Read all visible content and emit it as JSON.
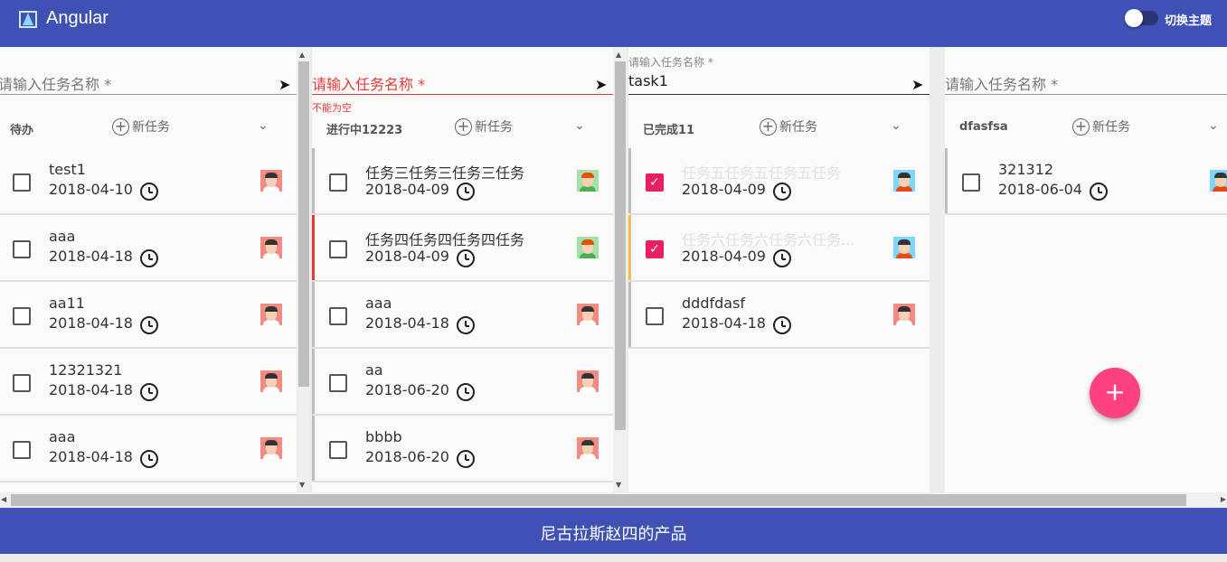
{
  "header": {
    "brand": "Angular",
    "theme_label": "切换主题"
  },
  "footer": {
    "text": "尼古拉斯赵四的产品"
  },
  "lists": [
    {
      "input": {
        "placeholder": "请输入任务名称 *",
        "value": "",
        "float_label": "",
        "error": ""
      },
      "title": "待办",
      "new_label": "新任务",
      "items": [
        {
          "desc": "test1",
          "date": "2018-04-10",
          "done": false
        },
        {
          "desc": "aaa",
          "date": "2018-04-18",
          "done": false
        },
        {
          "desc": "aa11",
          "date": "2018-04-18",
          "done": false
        },
        {
          "desc": "12321321",
          "date": "2018-04-18",
          "done": false
        },
        {
          "desc": "aaa",
          "date": "2018-04-18",
          "done": false
        }
      ]
    },
    {
      "input": {
        "placeholder": "请输入任务名称 *",
        "value": "",
        "float_label": "",
        "error": "不能为空"
      },
      "title": "进行中12223",
      "new_label": "新任务",
      "items": [
        {
          "desc": "任务三任务三任务三任务",
          "date": "2018-04-09",
          "done": false
        },
        {
          "desc": "任务四任务四任务四任务",
          "date": "2018-04-09",
          "done": false
        },
        {
          "desc": "aaa",
          "date": "2018-04-18",
          "done": false
        },
        {
          "desc": "aa",
          "date": "2018-06-20",
          "done": false
        },
        {
          "desc": "bbbb",
          "date": "2018-06-20",
          "done": false
        }
      ]
    },
    {
      "input": {
        "placeholder": "",
        "value": "task1",
        "float_label": "请输入任务名称 *",
        "error": ""
      },
      "title": "已完成11",
      "new_label": "新任务",
      "items": [
        {
          "desc": "任务五任务五任务五任务",
          "date": "2018-04-09",
          "done": true
        },
        {
          "desc": "任务六任务六任务六任务...",
          "date": "2018-04-09",
          "done": true
        },
        {
          "desc": "dddfdasf",
          "date": "2018-04-18",
          "done": false
        }
      ]
    },
    {
      "input": {
        "placeholder": "请输入任务名称 *",
        "value": "",
        "float_label": "",
        "error": ""
      },
      "title": "dfasfsa",
      "new_label": "新任务",
      "items": [
        {
          "desc": "321312",
          "date": "2018-06-04",
          "done": false
        }
      ]
    }
  ],
  "fab": {
    "label": "+"
  },
  "colors": {
    "primary": "#3f51b5",
    "accent": "#ff4081",
    "checkbox_on": "#e91e63",
    "priority_high": "#e53935",
    "priority_mid": "#ffb74d",
    "priority_low": "#bdbdbd"
  }
}
